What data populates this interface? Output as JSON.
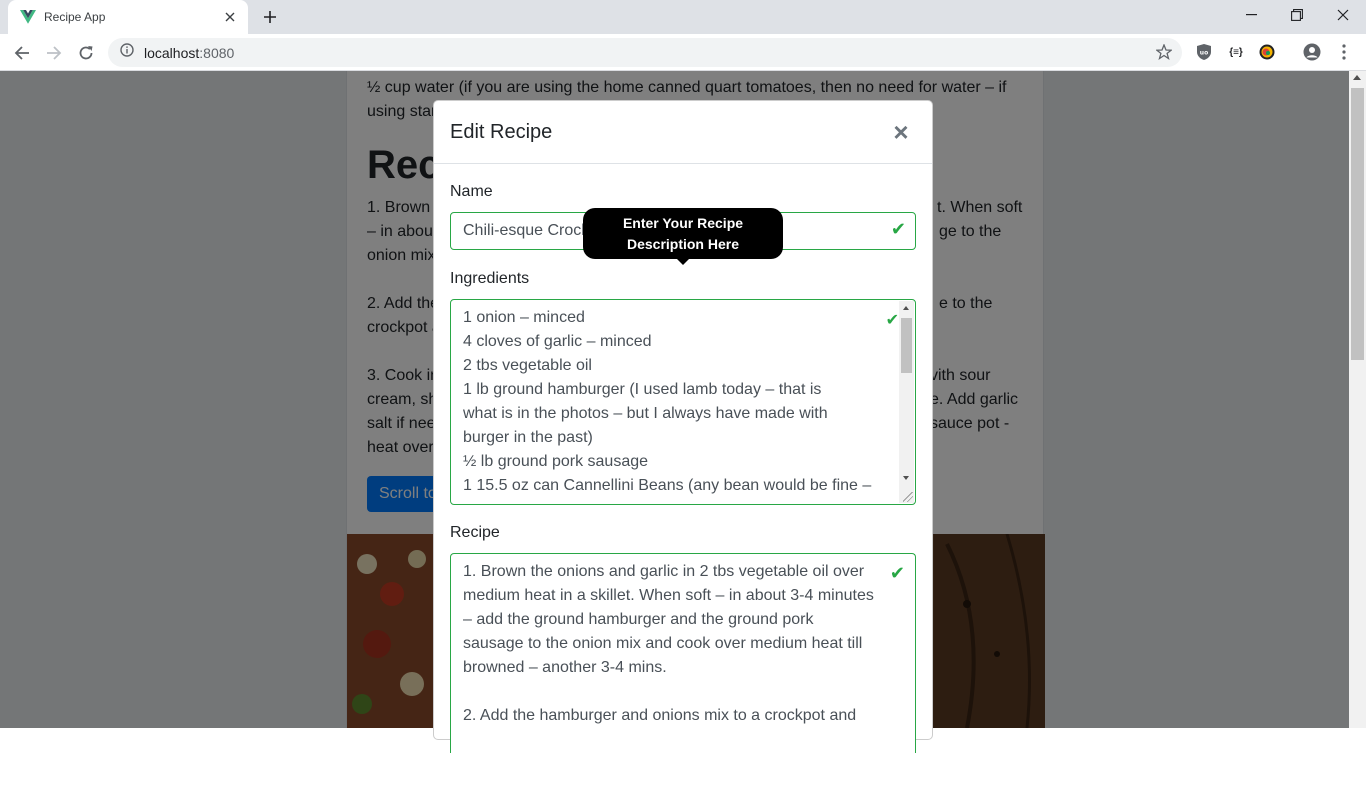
{
  "browser": {
    "tab_title": "Recipe App",
    "url_host": "localhost",
    "url_port": ":8080"
  },
  "background": {
    "cut_line": "",
    "water_line": "½ cup water (if you are using the home canned quart tomatoes, then no need for water – if using star",
    "heading": "Reci",
    "step1": [
      "1. Brown t",
      "– in about",
      "onion mix"
    ],
    "step1_right": [
      "t. When soft",
      "ge to the"
    ],
    "step2": [
      "2. Add the",
      "crockpot a"
    ],
    "step2_right": [
      "e to the"
    ],
    "step3": [
      "3. Cook in",
      "cream, sh",
      "salt if nee",
      "heat over"
    ],
    "step3_right": [
      "vith sour",
      "e. Add garlic",
      "sauce pot -"
    ],
    "scroll_button": "Scroll to"
  },
  "modal": {
    "title": "Edit Recipe",
    "close_label": "×",
    "name_label": "Name",
    "name_value": "Chili-esque Crock",
    "ingredients_label": "Ingredients",
    "ingredients_lines": [
      "1 onion – minced",
      "4 cloves of garlic – minced",
      "2 tbs vegetable oil",
      "1 lb ground hamburger (I used lamb today – that is",
      "what is in the photos – but I always have made with",
      "burger in the past)",
      "½ lb ground pork sausage",
      "1 15.5 oz can Cannellini Beans (any bean would be fine –"
    ],
    "recipe_label": "Recipe",
    "recipe_lines": [
      "1. Brown the onions and garlic in 2 tbs vegetable oil over",
      "medium heat in a skillet. When soft – in about 3-4 minutes",
      "– add the ground hamburger and the ground pork",
      "sausage to the onion mix and cook over medium heat till",
      "browned – another 3-4 mins.",
      "",
      "2. Add the hamburger and onions mix to a crockpot and"
    ],
    "tooltip_lines": [
      "Enter Your Recipe",
      "Description Here"
    ]
  },
  "colors": {
    "valid": "#28a745",
    "primary": "#007bff"
  },
  "icons": [
    "vue-logo-icon",
    "tab-close-icon",
    "new-tab-icon",
    "minimize-icon",
    "maximize-icon",
    "window-close-icon",
    "back-arrow-icon",
    "forward-arrow-icon",
    "reload-icon",
    "info-icon",
    "star-icon",
    "ublock-icon",
    "json-ext-icon",
    "color-ext-icon",
    "profile-icon",
    "menu-dots-icon",
    "check-icon"
  ]
}
